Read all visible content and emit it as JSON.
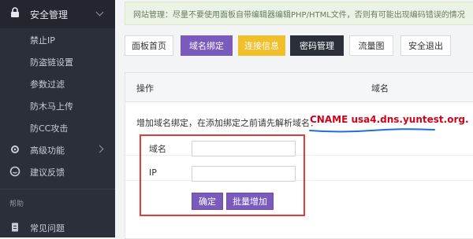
{
  "sidebar": {
    "section_security": "安全管理",
    "items": [
      {
        "label": "禁止IP"
      },
      {
        "label": "防盗链设置"
      },
      {
        "label": "参数过滤"
      },
      {
        "label": "防木马上传"
      },
      {
        "label": "防CC攻击"
      }
    ],
    "section_advanced": "高级功能",
    "feedback": "建议反馈",
    "help_header": "帮助",
    "faq": "常见问题"
  },
  "notice": {
    "text": "网站管理：尽量不要使用面板自带编辑器编辑PHP/HTML文件，否则有可能出现编码错误的情况"
  },
  "tabs": [
    {
      "label": "面板首页"
    },
    {
      "label": "域名绑定"
    },
    {
      "label": "连接信息"
    },
    {
      "label": "密码管理"
    },
    {
      "label": "流量图"
    },
    {
      "label": "安全退出"
    }
  ],
  "table": {
    "col_action": "操作",
    "col_domain": "域名"
  },
  "form": {
    "hint": "增加域名绑定，在添加绑定之前请先解析域名：",
    "cname": "CNAME usa4.dns.yuntest.org.",
    "domain_label": "域名",
    "domain_value": "",
    "ip_label": "IP",
    "ip_value": "",
    "confirm_label": "确定",
    "batch_label": "批量增加"
  },
  "colors": {
    "sidebar_bg": "#2b2f3a",
    "accent_purple": "#7a5bbd",
    "accent_yellow": "#f0bf2a",
    "cname_red": "#d0021b",
    "highlight_box_red": "#e23b3b",
    "wave_blue": "#1e6fd9"
  }
}
